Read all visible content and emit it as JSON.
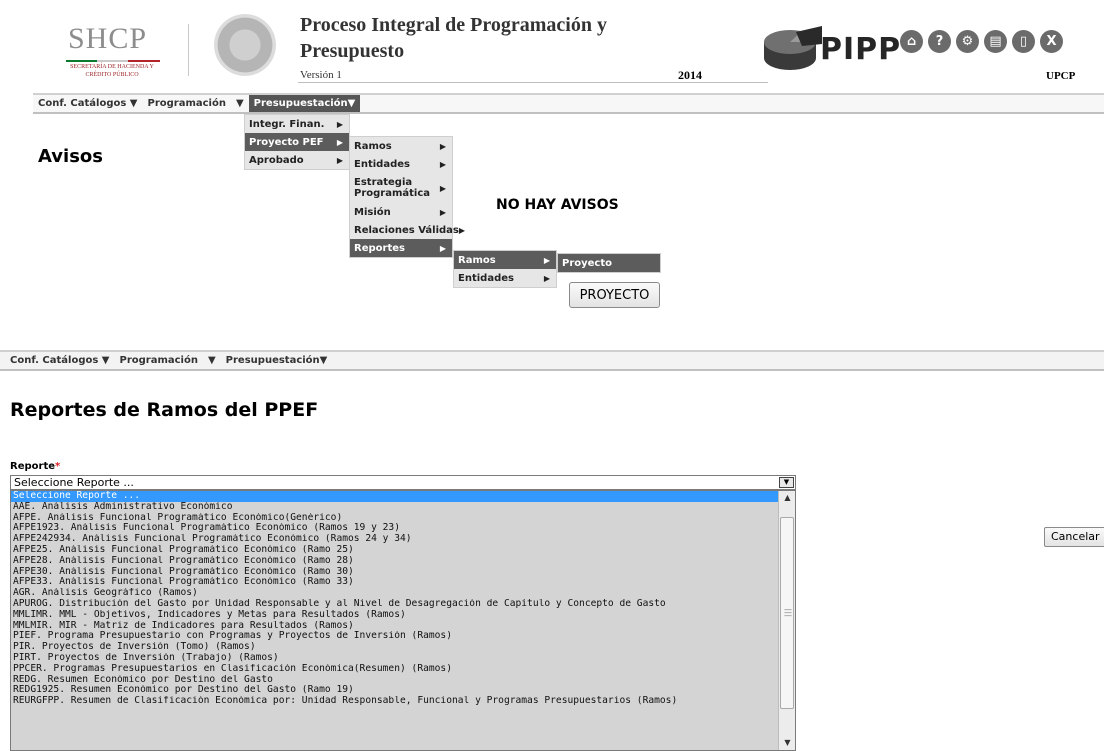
{
  "header": {
    "agency": "SHCP",
    "agency_sub": "SECRETARÍA DE HACIENDA Y CRÉDITO PÚBLICO",
    "title_line1": "Proceso Integral de Programación y",
    "title_line2": "Presupuesto",
    "version": "Versión 1",
    "year": "2014",
    "app_logo": "PIPP",
    "unit": "UPCP",
    "icons": [
      "home-icon",
      "help-icon",
      "settings-icon",
      "calculator-icon",
      "document-icon",
      "close-icon"
    ],
    "icon_glyphs": [
      "⌂",
      "?",
      "⚙",
      "▤",
      "▯",
      "X"
    ]
  },
  "menu_top": {
    "items": [
      "Conf. Catálogos ▼",
      "Programación",
      "▼",
      "Presupuestación▼"
    ]
  },
  "menu_presupuestacion": [
    "Integr. Finan.",
    "Proyecto PEF",
    "Aprobado"
  ],
  "menu_proyecto_pef": [
    "Ramos",
    "Entidades",
    "Estrategia Programática",
    "Misión",
    "Relaciones Válidas",
    "Reportes"
  ],
  "menu_reportes": [
    "Ramos",
    "Entidades"
  ],
  "menu_ramos": [
    "Proyecto"
  ],
  "avisos_title": "Avisos",
  "no_avisos": "NO HAY AVISOS",
  "proyecto_button": "PROYECTO",
  "menu_bottom": {
    "items": [
      "Conf. Catálogos ▼",
      "Programación",
      "▼",
      "Presupuestación▼"
    ]
  },
  "page_title": "Reportes de Ramos del PPEF",
  "reporte_label": "Reporte",
  "required_mark": "*",
  "reporte_selected": "Seleccione Reporte ...",
  "reporte_options": [
    "Seleccione Reporte ...",
    "AAE. Análisis Administrativo Económico",
    "AFPE. Análisis Funcional Programático Económico(Genérico)",
    "AFPE1923. Análisis Funcional Programático Económico (Ramos 19 y 23)",
    "AFPE242934. Análisis Funcional Programático Económico (Ramos 24 y 34)",
    "AFPE25. Análisis Funcional Programático Económico (Ramo 25)",
    "AFPE28. Análisis Funcional Programático Económico (Ramo 28)",
    "AFPE30. Análisis Funcional Programático Económico (Ramo 30)",
    "AFPE33. Análisis Funcional Programático Económico (Ramo 33)",
    "AGR. Análisis Geográfico (Ramos)",
    "APUROG. Distribución del Gasto por Unidad Responsable y al Nivel de Desagregación de Capítulo y Concepto de Gasto",
    "MMLIMR. MML - Objetivos, Indicadores y Metas para Resultados (Ramos)",
    "MMLMIR. MIR - Matriz de Indicadores para Resultados (Ramos)",
    "PIEF. Programa Presupuestario con Programas y Proyectos de Inversión (Ramos)",
    "PIR. Proyectos de Inversión (Tomo) (Ramos)",
    "PIRT. Proyectos de Inversión (Trabajo) (Ramos)",
    "PPCER. Programas Presupuestarios en Clasificación Económica(Resumen) (Ramos)",
    "REDG. Resumen Económico por Destino del Gasto",
    "REDG1925. Resumen Económico por Destino del Gasto (Ramo 19)",
    "REURGFPP. Resumen de Clasificación Económica por: Unidad Responsable, Funcional y Programas Presupuestarios (Ramos)"
  ],
  "cancel_button": "Cancelar",
  "colors": {
    "accent_blue": "#3399ff",
    "menu_active": "#555555"
  }
}
